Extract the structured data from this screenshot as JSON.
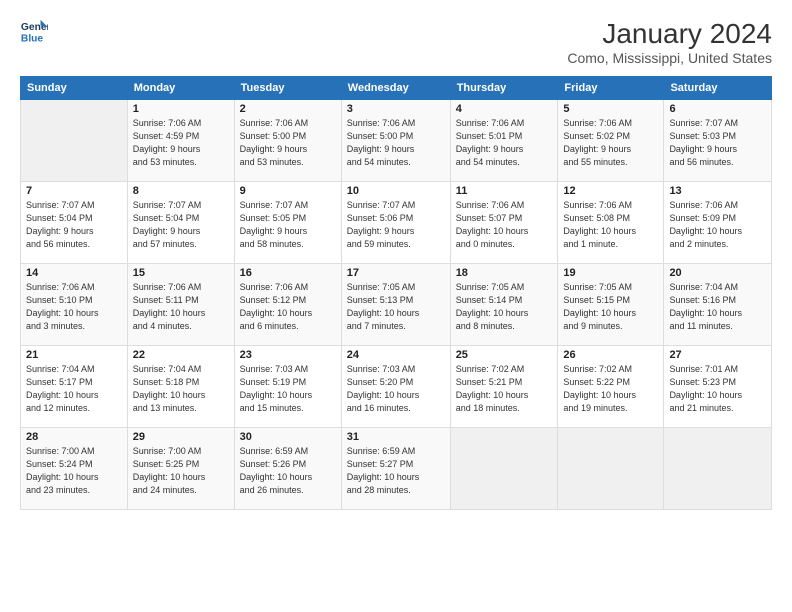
{
  "logo": {
    "line1": "General",
    "line2": "Blue"
  },
  "title": "January 2024",
  "subtitle": "Como, Mississippi, United States",
  "header_days": [
    "Sunday",
    "Monday",
    "Tuesday",
    "Wednesday",
    "Thursday",
    "Friday",
    "Saturday"
  ],
  "weeks": [
    [
      {
        "num": "",
        "info": ""
      },
      {
        "num": "1",
        "info": "Sunrise: 7:06 AM\nSunset: 4:59 PM\nDaylight: 9 hours\nand 53 minutes."
      },
      {
        "num": "2",
        "info": "Sunrise: 7:06 AM\nSunset: 5:00 PM\nDaylight: 9 hours\nand 53 minutes."
      },
      {
        "num": "3",
        "info": "Sunrise: 7:06 AM\nSunset: 5:00 PM\nDaylight: 9 hours\nand 54 minutes."
      },
      {
        "num": "4",
        "info": "Sunrise: 7:06 AM\nSunset: 5:01 PM\nDaylight: 9 hours\nand 54 minutes."
      },
      {
        "num": "5",
        "info": "Sunrise: 7:06 AM\nSunset: 5:02 PM\nDaylight: 9 hours\nand 55 minutes."
      },
      {
        "num": "6",
        "info": "Sunrise: 7:07 AM\nSunset: 5:03 PM\nDaylight: 9 hours\nand 56 minutes."
      }
    ],
    [
      {
        "num": "7",
        "info": "Sunrise: 7:07 AM\nSunset: 5:04 PM\nDaylight: 9 hours\nand 56 minutes."
      },
      {
        "num": "8",
        "info": "Sunrise: 7:07 AM\nSunset: 5:04 PM\nDaylight: 9 hours\nand 57 minutes."
      },
      {
        "num": "9",
        "info": "Sunrise: 7:07 AM\nSunset: 5:05 PM\nDaylight: 9 hours\nand 58 minutes."
      },
      {
        "num": "10",
        "info": "Sunrise: 7:07 AM\nSunset: 5:06 PM\nDaylight: 9 hours\nand 59 minutes."
      },
      {
        "num": "11",
        "info": "Sunrise: 7:06 AM\nSunset: 5:07 PM\nDaylight: 10 hours\nand 0 minutes."
      },
      {
        "num": "12",
        "info": "Sunrise: 7:06 AM\nSunset: 5:08 PM\nDaylight: 10 hours\nand 1 minute."
      },
      {
        "num": "13",
        "info": "Sunrise: 7:06 AM\nSunset: 5:09 PM\nDaylight: 10 hours\nand 2 minutes."
      }
    ],
    [
      {
        "num": "14",
        "info": "Sunrise: 7:06 AM\nSunset: 5:10 PM\nDaylight: 10 hours\nand 3 minutes."
      },
      {
        "num": "15",
        "info": "Sunrise: 7:06 AM\nSunset: 5:11 PM\nDaylight: 10 hours\nand 4 minutes."
      },
      {
        "num": "16",
        "info": "Sunrise: 7:06 AM\nSunset: 5:12 PM\nDaylight: 10 hours\nand 6 minutes."
      },
      {
        "num": "17",
        "info": "Sunrise: 7:05 AM\nSunset: 5:13 PM\nDaylight: 10 hours\nand 7 minutes."
      },
      {
        "num": "18",
        "info": "Sunrise: 7:05 AM\nSunset: 5:14 PM\nDaylight: 10 hours\nand 8 minutes."
      },
      {
        "num": "19",
        "info": "Sunrise: 7:05 AM\nSunset: 5:15 PM\nDaylight: 10 hours\nand 9 minutes."
      },
      {
        "num": "20",
        "info": "Sunrise: 7:04 AM\nSunset: 5:16 PM\nDaylight: 10 hours\nand 11 minutes."
      }
    ],
    [
      {
        "num": "21",
        "info": "Sunrise: 7:04 AM\nSunset: 5:17 PM\nDaylight: 10 hours\nand 12 minutes."
      },
      {
        "num": "22",
        "info": "Sunrise: 7:04 AM\nSunset: 5:18 PM\nDaylight: 10 hours\nand 13 minutes."
      },
      {
        "num": "23",
        "info": "Sunrise: 7:03 AM\nSunset: 5:19 PM\nDaylight: 10 hours\nand 15 minutes."
      },
      {
        "num": "24",
        "info": "Sunrise: 7:03 AM\nSunset: 5:20 PM\nDaylight: 10 hours\nand 16 minutes."
      },
      {
        "num": "25",
        "info": "Sunrise: 7:02 AM\nSunset: 5:21 PM\nDaylight: 10 hours\nand 18 minutes."
      },
      {
        "num": "26",
        "info": "Sunrise: 7:02 AM\nSunset: 5:22 PM\nDaylight: 10 hours\nand 19 minutes."
      },
      {
        "num": "27",
        "info": "Sunrise: 7:01 AM\nSunset: 5:23 PM\nDaylight: 10 hours\nand 21 minutes."
      }
    ],
    [
      {
        "num": "28",
        "info": "Sunrise: 7:00 AM\nSunset: 5:24 PM\nDaylight: 10 hours\nand 23 minutes."
      },
      {
        "num": "29",
        "info": "Sunrise: 7:00 AM\nSunset: 5:25 PM\nDaylight: 10 hours\nand 24 minutes."
      },
      {
        "num": "30",
        "info": "Sunrise: 6:59 AM\nSunset: 5:26 PM\nDaylight: 10 hours\nand 26 minutes."
      },
      {
        "num": "31",
        "info": "Sunrise: 6:59 AM\nSunset: 5:27 PM\nDaylight: 10 hours\nand 28 minutes."
      },
      {
        "num": "",
        "info": ""
      },
      {
        "num": "",
        "info": ""
      },
      {
        "num": "",
        "info": ""
      }
    ]
  ]
}
